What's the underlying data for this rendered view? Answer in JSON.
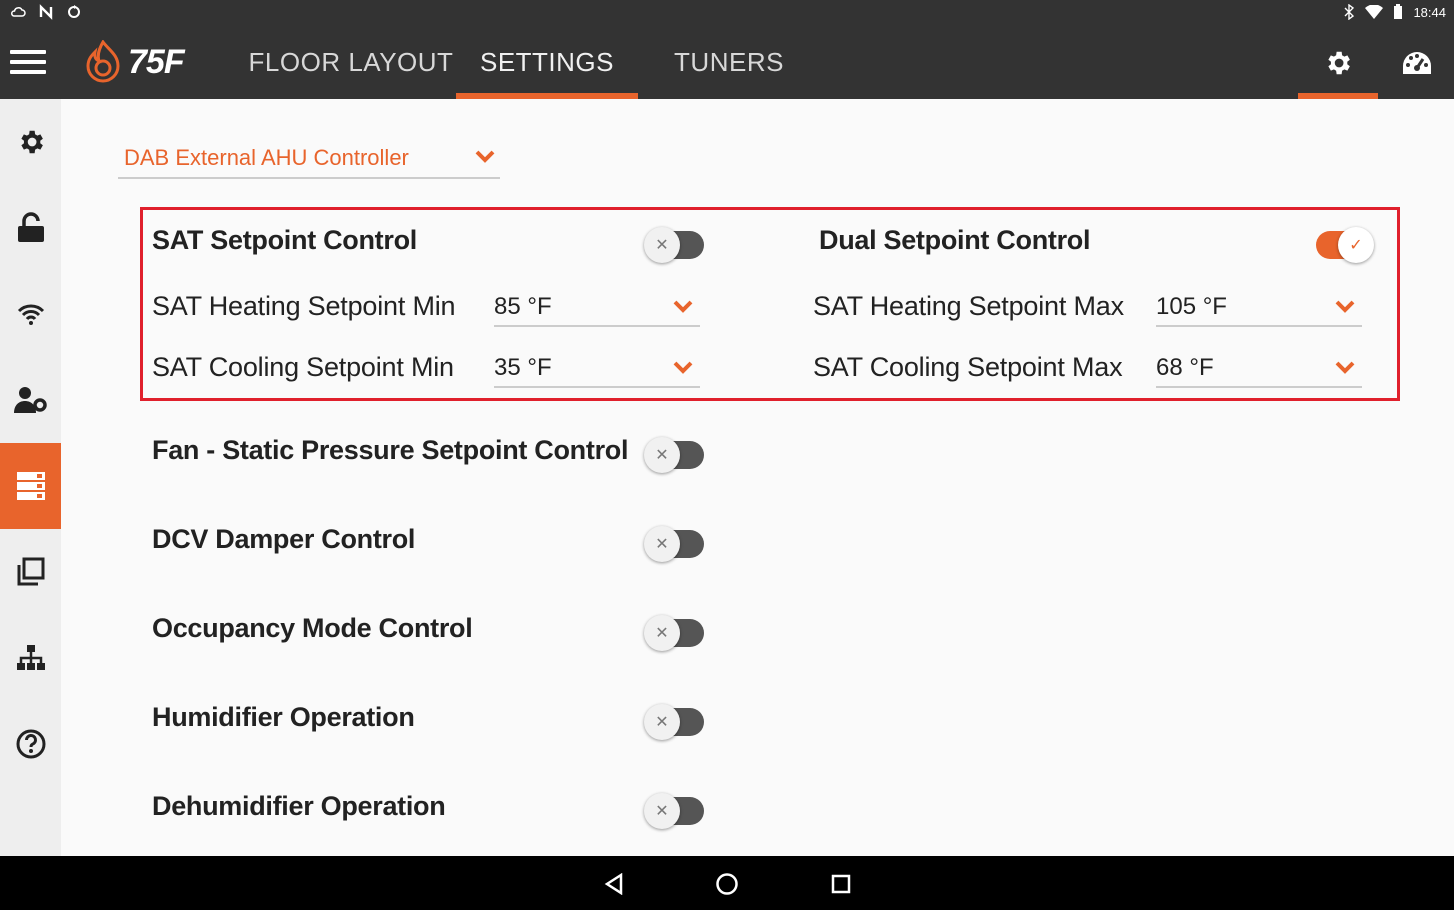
{
  "statusbar": {
    "time": "18:44"
  },
  "header": {
    "logo_text": "75F",
    "tabs": [
      {
        "label": "FLOOR LAYOUT"
      },
      {
        "label": "SETTINGS"
      },
      {
        "label": "TUNERS"
      }
    ]
  },
  "profile_select": {
    "value": "DAB External AHU Controller"
  },
  "sat_section": {
    "sat_setpoint_control": {
      "label": "SAT Setpoint Control",
      "enabled": false
    },
    "dual_setpoint_control": {
      "label": "Dual Setpoint Control",
      "enabled": true
    },
    "heating_min": {
      "label": "SAT Heating Setpoint Min",
      "value": "85 °F"
    },
    "cooling_min": {
      "label": "SAT Cooling Setpoint Min",
      "value": "35 °F"
    },
    "heating_max": {
      "label": "SAT Heating Setpoint Max",
      "value": "105 °F"
    },
    "cooling_max": {
      "label": "SAT Cooling Setpoint Max",
      "value": "68 °F"
    }
  },
  "controls": [
    {
      "label": "Fan - Static Pressure Setpoint Control",
      "enabled": false
    },
    {
      "label": "DCV Damper Control",
      "enabled": false
    },
    {
      "label": "Occupancy Mode Control",
      "enabled": false
    },
    {
      "label": "Humidifier Operation",
      "enabled": false
    },
    {
      "label": "Dehumidifier Operation",
      "enabled": false
    }
  ],
  "colors": {
    "accent": "#e8642c",
    "header_bg": "#333333",
    "highlight": "#e0202c"
  }
}
